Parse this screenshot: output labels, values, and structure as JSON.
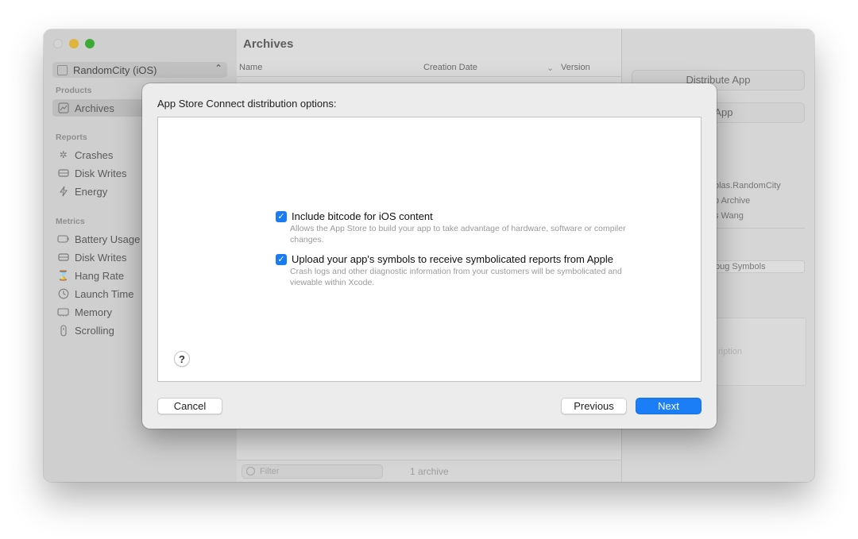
{
  "window": {
    "sidebar": {
      "scheme": "RandomCity (iOS)",
      "sections": [
        {
          "label": "Products",
          "items": [
            {
              "label": "Archives",
              "icon": "archive-icon",
              "selected": true
            }
          ]
        },
        {
          "label": "Reports",
          "items": [
            {
              "label": "Crashes",
              "icon": "crash-icon"
            },
            {
              "label": "Disk Writes",
              "icon": "disk-icon"
            },
            {
              "label": "Energy",
              "icon": "bolt-icon"
            }
          ]
        },
        {
          "label": "Metrics",
          "items": [
            {
              "label": "Battery Usage",
              "icon": "battery-icon"
            },
            {
              "label": "Disk Writes",
              "icon": "disk-icon"
            },
            {
              "label": "Hang Rate",
              "icon": "hourglass-icon"
            },
            {
              "label": "Launch Time",
              "icon": "clock-icon"
            },
            {
              "label": "Memory",
              "icon": "memory-icon"
            },
            {
              "label": "Scrolling",
              "icon": "scroll-icon"
            }
          ]
        }
      ]
    },
    "main": {
      "title": "Archives",
      "columns": {
        "name": "Name",
        "creation_date": "Creation Date",
        "version": "Version"
      },
      "filter_placeholder": "Filter",
      "count": "1 archive"
    },
    "inspector": {
      "distribute_button": "Distribute App",
      "validate_button_partial": "te App",
      "identifier_partial": "olas.RandomCity",
      "type_partial": "p Archive",
      "team_partial": "s Wang",
      "debug_symbols_partial": "bug Symbols",
      "description_partial": "ription"
    }
  },
  "dialog": {
    "title": "App Store Connect distribution options:",
    "options": [
      {
        "label": "Include bitcode for iOS content",
        "description": "Allows the App Store to build your app to take advantage of hardware, software or compiler changes.",
        "checked": true
      },
      {
        "label": "Upload your app's symbols to receive symbolicated reports from Apple",
        "description": "Crash logs and other diagnostic information from your customers will be symbolicated and viewable within Xcode.",
        "checked": true
      }
    ],
    "help": "?",
    "cancel": "Cancel",
    "previous": "Previous",
    "next": "Next"
  },
  "colors": {
    "accent": "#1b7ef6",
    "checkbox": "#1a7cf5"
  }
}
